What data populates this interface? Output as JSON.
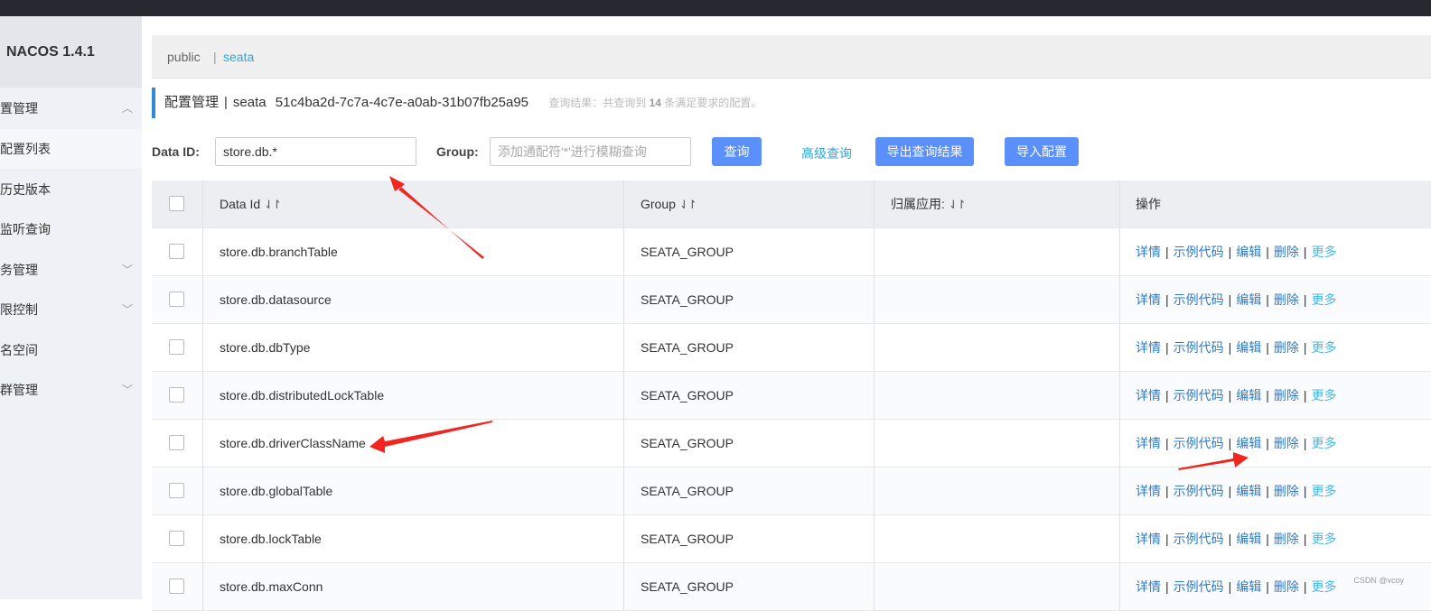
{
  "app": {
    "title": "NACOS 1.4.1"
  },
  "sidebar": {
    "items": [
      {
        "label": "置管理",
        "chevron": "up"
      },
      {
        "label": "配置列表"
      },
      {
        "label": "历史版本"
      },
      {
        "label": "监听查询"
      },
      {
        "label": "务管理",
        "chevron": "down"
      },
      {
        "label": "限控制",
        "chevron": "down"
      },
      {
        "label": "名空间"
      },
      {
        "label": "群管理",
        "chevron": "down"
      }
    ]
  },
  "namespace": {
    "public": "public",
    "separator": "|",
    "active": "seata"
  },
  "header": {
    "title": "配置管理",
    "separator": "|",
    "namespace": "seata",
    "namespace_id": "51c4ba2d-7c7a-4c7e-a0ab-31b07fb25a95",
    "result_prefix": "查询结果：共查询到",
    "result_count": "14",
    "result_suffix": "条满足要求的配置。"
  },
  "filter": {
    "data_id_label": "Data ID:",
    "data_id_value": "store.db.*",
    "group_label": "Group:",
    "group_placeholder": "添加通配符'*'进行模糊查询",
    "query_button": "查询",
    "advanced_link": "高级查询",
    "export_button": "导出查询结果",
    "import_button": "导入配置"
  },
  "table": {
    "columns": {
      "data_id": "Data Id",
      "group": "Group",
      "app": "归属应用:",
      "ops": "操作"
    },
    "sort_icon": "⇃↾",
    "ops": {
      "detail": "详情",
      "sample": "示例代码",
      "edit": "编辑",
      "delete": "删除",
      "more": "更多",
      "sep": "|"
    },
    "rows": [
      {
        "data_id": "store.db.branchTable",
        "group": "SEATA_GROUP",
        "app": ""
      },
      {
        "data_id": "store.db.datasource",
        "group": "SEATA_GROUP",
        "app": ""
      },
      {
        "data_id": "store.db.dbType",
        "group": "SEATA_GROUP",
        "app": ""
      },
      {
        "data_id": "store.db.distributedLockTable",
        "group": "SEATA_GROUP",
        "app": ""
      },
      {
        "data_id": "store.db.driverClassName",
        "group": "SEATA_GROUP",
        "app": ""
      },
      {
        "data_id": "store.db.globalTable",
        "group": "SEATA_GROUP",
        "app": ""
      },
      {
        "data_id": "store.db.lockTable",
        "group": "SEATA_GROUP",
        "app": ""
      },
      {
        "data_id": "store.db.maxConn",
        "group": "SEATA_GROUP",
        "app": ""
      }
    ]
  },
  "watermark": "CSDN @vcoy",
  "annotation_color": "#f0261f"
}
